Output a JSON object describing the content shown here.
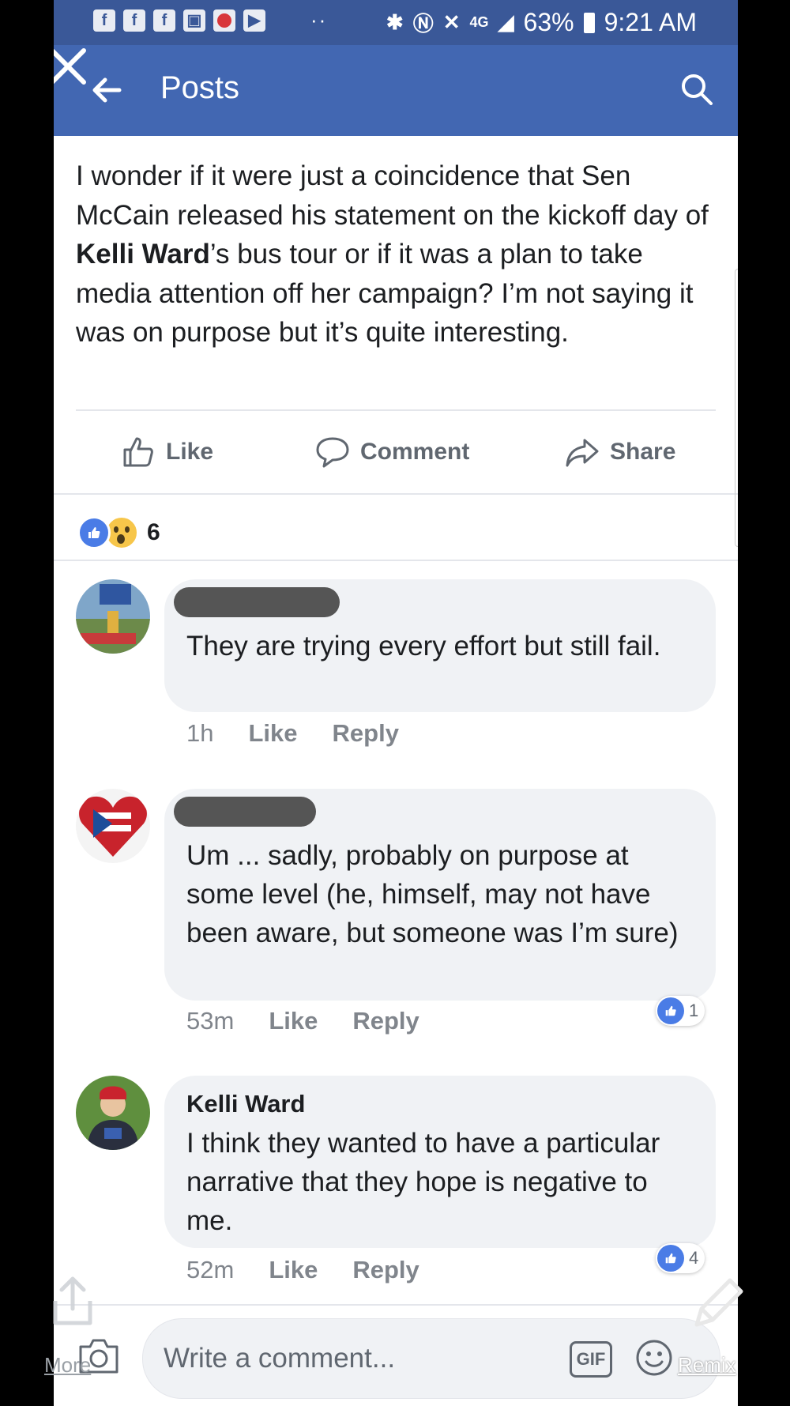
{
  "statusbar": {
    "battery": "63%",
    "time": "9:21 AM",
    "dots": "··",
    "sim": "4G"
  },
  "header": {
    "title": "Posts"
  },
  "post": {
    "text_before": "I wonder if it were just a coincidence that Sen McCain released his statement on the kickoff day of ",
    "mention": "Kelli Ward",
    "text_after": "’s bus tour or if it was a plan to take media attention off her campaign? I’m not saying it was on purpose but it’s quite interesting."
  },
  "actions": {
    "like": "Like",
    "comment": "Comment",
    "share": "Share"
  },
  "reactions": {
    "count": "6"
  },
  "comments": [
    {
      "name": "",
      "text": "They are trying every effort but still fail.",
      "time": "1h",
      "like": "Like",
      "reply": "Reply",
      "reacts": ""
    },
    {
      "name": "",
      "text": "Um ... sadly, probably on purpose at some level (he, himself, may not have been aware, but someone was I’m sure)",
      "time": "53m",
      "like": "Like",
      "reply": "Reply",
      "reacts": "1"
    },
    {
      "name": "Kelli Ward",
      "text": "I think they wanted to have a particular narrative that they hope is negative to me.",
      "time": "52m",
      "like": "Like",
      "reply": "Reply",
      "reacts": "4"
    }
  ],
  "composer": {
    "placeholder": "Write a comment...",
    "gif": "GIF"
  },
  "overlay": {
    "more": "More",
    "remix": "Remix"
  },
  "colors": {
    "header": "#4267b2",
    "statusbar": "#3a5898",
    "like_blue": "#4a7ce6",
    "bubble": "#f0f2f5"
  }
}
